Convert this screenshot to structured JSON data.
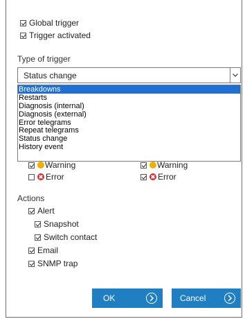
{
  "trigger_options": {
    "global_trigger": {
      "label": "Global trigger",
      "checked": true
    },
    "trigger_activated": {
      "label": "Trigger activated",
      "checked": true
    }
  },
  "type_of_trigger": {
    "label": "Type of trigger",
    "selected_value": "Status change",
    "dropdown_open": true,
    "highlighted_option": "Breakdowns",
    "options": [
      "Breakdowns",
      "Restarts",
      "Diagnosis (internal)",
      "Diagnosis (external)",
      "Error telegrams",
      "Repeat telegrams",
      "Status change",
      "History event"
    ]
  },
  "severity_left": {
    "warning": {
      "label": "Warning",
      "checked": true
    },
    "error": {
      "label": "Error",
      "checked": false
    }
  },
  "severity_right": {
    "warning": {
      "label": "Warning",
      "checked": true
    },
    "error": {
      "label": "Error",
      "checked": true
    }
  },
  "actions": {
    "label": "Actions",
    "alert": {
      "label": "Alert",
      "checked": true
    },
    "snapshot": {
      "label": "Snapshot",
      "checked": true
    },
    "switch_contact": {
      "label": "Switch contact",
      "checked": true
    },
    "email": {
      "label": "Email",
      "checked": true
    },
    "snmp_trap": {
      "label": "SNMP trap",
      "checked": true
    }
  },
  "buttons": {
    "ok": "OK",
    "cancel": "Cancel"
  },
  "colors": {
    "accent_button": "#1f7fc2",
    "highlight": "#1e70d6",
    "warning": "#f0b000",
    "error": "#d72f2f"
  },
  "icons": {
    "checkbox": "checkbox-icon",
    "warning": "warning-icon",
    "error": "error-icon",
    "chevron_down": "chevron-down-icon",
    "chevron_right": "chevron-right-circle-icon"
  }
}
